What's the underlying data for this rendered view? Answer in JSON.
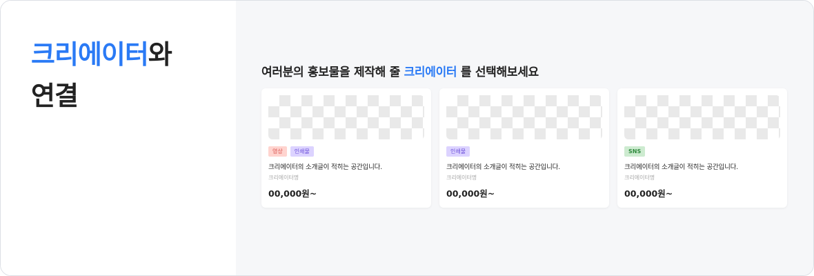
{
  "hero": {
    "title_accent": "크리에이터",
    "title_rest": "와",
    "title_line2": "연결"
  },
  "section": {
    "heading_prefix": "여러분의 홍보물을 제작해 줄 ",
    "heading_accent": "크리에이터",
    "heading_suffix": " 를 선택해보세요"
  },
  "cards": [
    {
      "tags": [
        {
          "label": "영상",
          "type": "video"
        },
        {
          "label": "인쇄물",
          "type": "print"
        }
      ],
      "description": "크리에이터의 소개글이 적히는 공간입니다.",
      "creator": "크리에이터명",
      "price": "00,000원~"
    },
    {
      "tags": [
        {
          "label": "인쇄물",
          "type": "print"
        }
      ],
      "description": "크리에이터의 소개글이 적히는 공간입니다.",
      "creator": "크리에이터명",
      "price": "00,000원~"
    },
    {
      "tags": [
        {
          "label": "SNS",
          "type": "sns"
        }
      ],
      "description": "크리에이터의 소개글이 적히는 공간입니다.",
      "creator": "크리에이터명",
      "price": "00,000원~"
    }
  ],
  "colors": {
    "accent": "#2a7af5",
    "panel_bg": "#f6f7f9",
    "tag_video_bg": "#ffd4cf",
    "tag_print_bg": "#dcd3ff",
    "tag_sns_bg": "#cdebd0"
  }
}
